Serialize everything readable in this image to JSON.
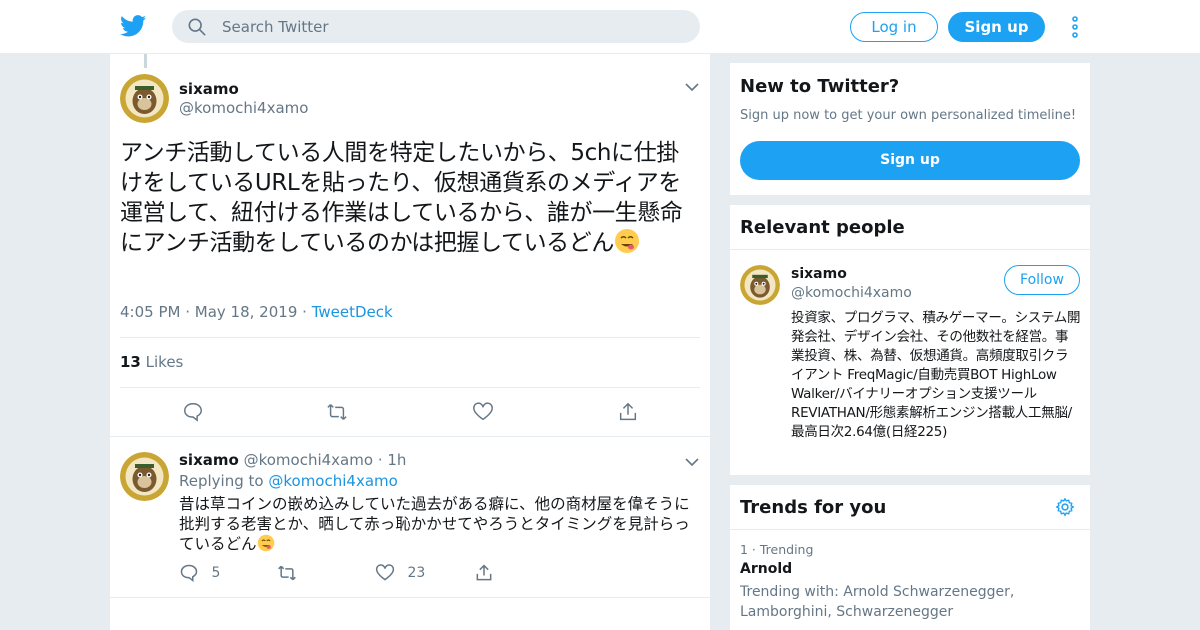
{
  "header": {
    "search_placeholder": "Search Twitter",
    "login_label": "Log in",
    "signup_label": "Sign up"
  },
  "tweet": {
    "name": "sixamo",
    "handle": "@komochi4xamo",
    "text": "アンチ活動している人間を特定したいから、5chに仕掛けをしているURLを貼ったり、仮想通貨系のメディアを運営して、紐付ける作業はしているから、誰が一生懸命にアンチ活動をしているのかは把握しているどん",
    "time": "4:05 PM",
    "date": "May 18, 2019",
    "source": "TweetDeck",
    "likes_count": "13",
    "likes_label": "Likes"
  },
  "reply": {
    "name": "sixamo",
    "handle": "@komochi4xamo",
    "age": "1h",
    "replying_prefix": "Replying to",
    "replying_to": "@komochi4xamo",
    "text": "昔は草コインの嵌め込みしていた過去がある癖に、他の商材屋を偉そうに批判する老害とか、晒して赤っ恥かかせてやろうとタイミングを見計らっているどん",
    "reply_count": "5",
    "like_count": "23"
  },
  "sidebar": {
    "new_title": "New to Twitter?",
    "new_sub": "Sign up now to get your own personalized timeline!",
    "new_button": "Sign up",
    "people_title": "Relevant people",
    "person": {
      "name": "sixamo",
      "handle": "@komochi4xamo",
      "follow_label": "Follow",
      "bio": "投資家、プログラマ、積みゲーマー。システム開発会社、デザイン会社、その他数社を経営。事業投資、株、為替、仮想通貨。高頻度取引クライアント FreqMagic/自動売買BOT HighLow Walker/バイナリーオプション支援ツール REVIATHAN/形態素解析エンジン搭載人工無脳/最高日次2.64億(日経225)"
    },
    "trends_title": "Trends for you",
    "trend": {
      "rank": "1 · Trending",
      "name": "Arnold",
      "with": "Trending with: Arnold Schwarzenegger, Lamborghini, Schwarzenegger"
    }
  },
  "colors": {
    "accent": "#1da1f2",
    "background": "#e6ecf0",
    "muted": "#657786"
  },
  "icons": [
    "twitter-bird-icon",
    "search-icon",
    "more-icon",
    "chevron-down-icon",
    "reply-icon",
    "retweet-icon",
    "like-icon",
    "share-icon",
    "gear-icon",
    "emoji-yum-icon"
  ]
}
